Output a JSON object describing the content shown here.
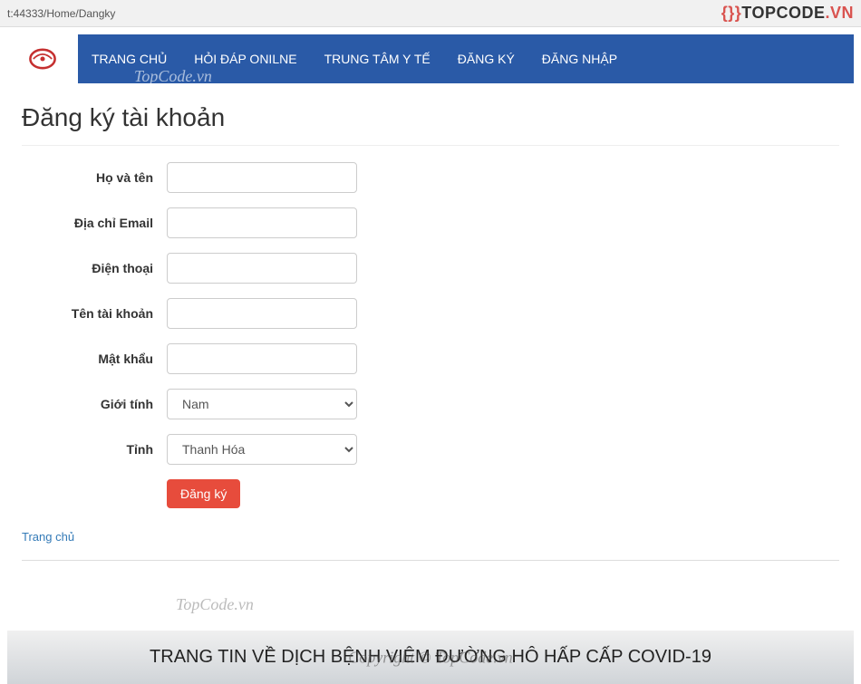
{
  "address_bar": "t:44333/Home/Dangky",
  "topwatermark": {
    "brace": "{}}",
    "brand": "TOPCODE",
    "vn": ".VN"
  },
  "nav": {
    "watermark": "TopCode.vn",
    "items": [
      {
        "label": "TRANG CHỦ"
      },
      {
        "label": "HỎI ĐÁP ONILNE"
      },
      {
        "label": "TRUNG TÂM Y TẾ"
      },
      {
        "label": "ĐĂNG KÝ"
      },
      {
        "label": "ĐĂNG NHẬP"
      }
    ]
  },
  "page": {
    "title": "Đăng ký tài khoản"
  },
  "form": {
    "fullname_label": "Họ và tên",
    "email_label": "Địa chỉ Email",
    "phone_label": "Điện thoại",
    "username_label": "Tên tài khoản",
    "password_label": "Mật khẩu",
    "gender_label": "Giới tính",
    "gender_value": "Nam",
    "province_label": "Tỉnh",
    "province_value": "Thanh Hóa",
    "submit_label": "Đăng ký"
  },
  "breadcrumb": {
    "home": "Trang chủ"
  },
  "midwatermark": "TopCode.vn",
  "footer": {
    "banner": "TRANG TIN VỀ DỊCH BỆNH VIÊM ĐƯỜNG HÔ HẤP CẤP COVID-19",
    "overlay": "Copyright © TopCode.vn"
  }
}
